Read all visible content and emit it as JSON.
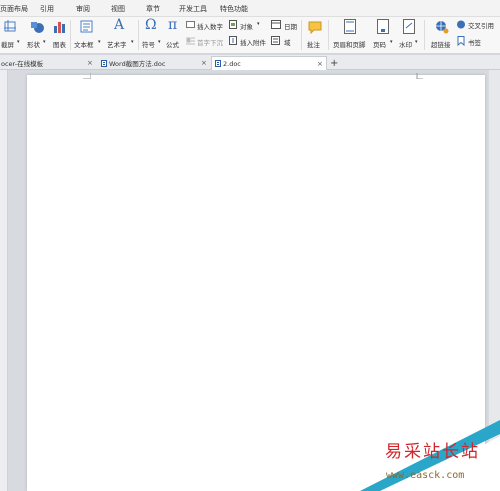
{
  "menu": {
    "items": [
      "页面布局",
      "引用",
      "审阅",
      "视图",
      "章节",
      "开发工具",
      "特色功能"
    ]
  },
  "ribbon": {
    "screenshot": "截屏",
    "shape": "形状",
    "chart": "图表",
    "textbox": "文本框",
    "wordart": "艺术字",
    "symbol": "符号",
    "formula": "公式",
    "insert_number": "插入数字",
    "object": "对象",
    "date": "日期",
    "first_char_sink": "首字下沉",
    "insert_attachment": "插入附件",
    "field": "域",
    "comment": "批注",
    "header_footer": "页眉和页脚",
    "page_number": "页码",
    "watermark": "水印",
    "hyperlink": "超链接",
    "cross_reference": "交叉引用",
    "bookmark": "书签"
  },
  "tabs": [
    {
      "label": "ocer-在线模板"
    },
    {
      "label": "Word截图方法.doc"
    },
    {
      "label": "2.doc"
    }
  ],
  "new_tab_symbol": "+",
  "close_symbol": "×",
  "watermark": {
    "brand": "易采站长站",
    "url": "www.easck.com"
  },
  "colors": {
    "accent_blue": "#2b5ea8",
    "brand_red": "#d0262b",
    "corner_teal": "#2aa6c8"
  }
}
